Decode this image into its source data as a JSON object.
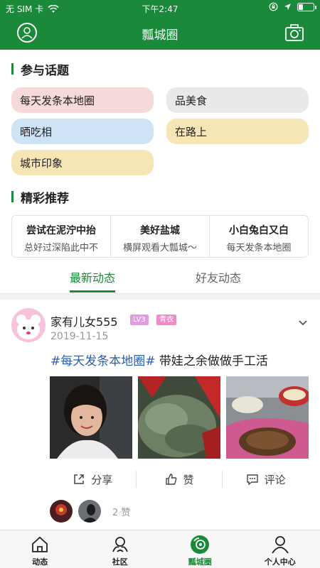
{
  "status": {
    "carrier": "无 SIM 卡",
    "time": "下午2:47"
  },
  "header": {
    "title": "瓢城圈"
  },
  "topics_section": {
    "title": "参与话题",
    "items": [
      {
        "label": "每天发条本地圈",
        "color": "#f6d9d9"
      },
      {
        "label": "品美食",
        "color": "#e9e9e9"
      },
      {
        "label": "晒吃相",
        "color": "#cfe3f6"
      },
      {
        "label": "在路上",
        "color": "#f7e6b5"
      },
      {
        "label": "城市印象",
        "color": "#f7e6b5"
      }
    ]
  },
  "recommend_section": {
    "title": "精彩推荐",
    "items": [
      {
        "title": "尝试在泥泞中抬",
        "subtitle": "总好过深陷此中不"
      },
      {
        "title": "美好盐城",
        "subtitle": "横屏观看大瓢城～"
      },
      {
        "title": "小白兔白又白",
        "subtitle": "每天发条本地圈"
      }
    ]
  },
  "tabs": [
    {
      "label": "最新动态",
      "active": true
    },
    {
      "label": "好友动态",
      "active": false
    }
  ],
  "post": {
    "username": "家有儿女555",
    "level_badge": "LV3",
    "level_color": "#e49be3",
    "title_badge": "青衣",
    "title_color": "#f28ac8",
    "date": "2019-11-15",
    "hashtag": "#每天发条本地圈#",
    "text": " 带娃之余做做手工活",
    "actions": {
      "share": "分享",
      "like": "赞",
      "comment": "评论"
    },
    "likes_count": "2 赞"
  },
  "bottom_nav": [
    {
      "label": "动态",
      "icon": "home-icon"
    },
    {
      "label": "社区",
      "icon": "community-icon"
    },
    {
      "label": "瓢城圈",
      "icon": "circle-icon"
    },
    {
      "label": "个人中心",
      "icon": "person-icon"
    }
  ],
  "colors": {
    "brand": "#1a8a3a",
    "link": "#2a5db0"
  }
}
